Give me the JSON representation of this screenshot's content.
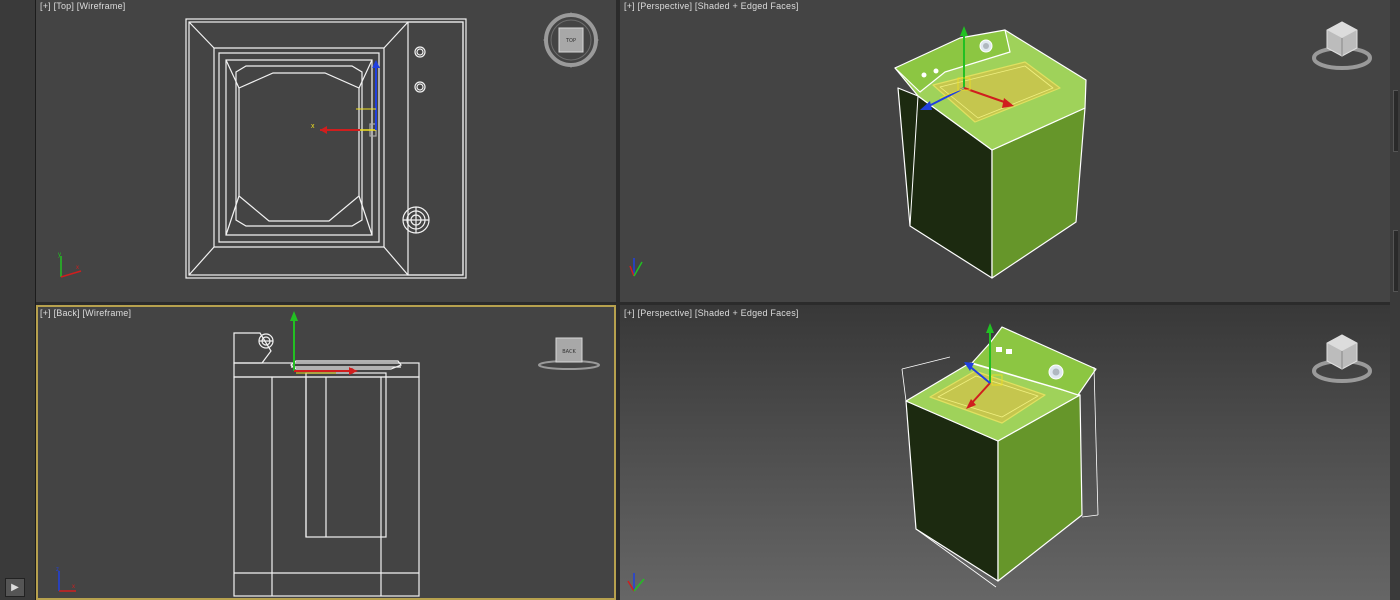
{
  "viewports": {
    "top": {
      "label_parts": [
        "[+]",
        "[Top]",
        "[Wireframe]"
      ],
      "nav_cube_face": "TOP"
    },
    "persp1": {
      "label_parts": [
        "[+]",
        "[Perspective]",
        "[Shaded + Edged Faces]"
      ]
    },
    "back": {
      "label_parts": [
        "[+]",
        "[Back]",
        "[Wireframe]"
      ],
      "nav_cube_face": "BACK",
      "active": true
    },
    "persp2": {
      "label_parts": [
        "[+]",
        "[Perspective]",
        "[Shaded + Edged Faces]"
      ]
    }
  },
  "colors": {
    "viewport_bg": "#444444",
    "active_border": "#b7a14e",
    "model_green": "#6a9c2c",
    "model_dark": "#1c2a10",
    "axis_x": "#d01e1e",
    "axis_y": "#22c022",
    "axis_z": "#2040e0"
  },
  "icons": {
    "play": "play-icon",
    "nav_cube": "view-cube-icon",
    "axis_tripod": "axis-tripod-icon",
    "gizmo": "transform-gizmo-icon"
  },
  "axis_letters": {
    "x": "x",
    "y": "y",
    "z": "z"
  }
}
